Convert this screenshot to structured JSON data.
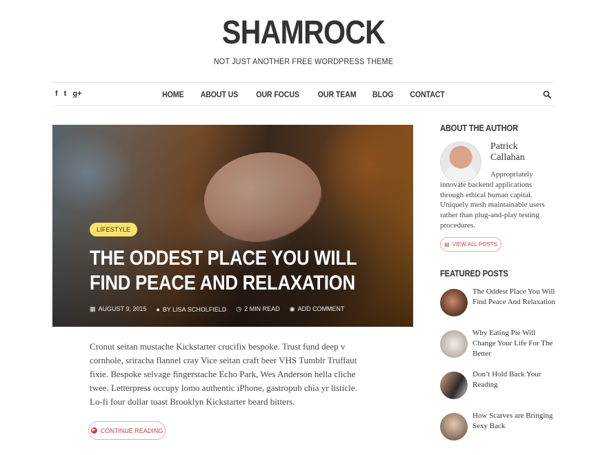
{
  "site": {
    "title": "SHAMROCK",
    "tagline": "NOT JUST ANOTHER FREE WORDPRESS THEME"
  },
  "social": [
    "f",
    "t",
    "g+"
  ],
  "nav": {
    "items": [
      "HOME",
      "ABOUT US",
      "OUR FOCUS",
      "OUR TEAM",
      "BLOG",
      "CONTACT"
    ]
  },
  "hero": {
    "category": "LIFESTYLE",
    "title": "THE ODDEST PLACE YOU WILL FIND PEACE AND RELAXATION",
    "date": "AUGUST 9, 2015",
    "author": "BY LISA SCHOLFIELD",
    "read_time": "2 MIN READ",
    "comments": "ADD COMMENT"
  },
  "post": {
    "excerpt": "Cronut seitan mustache Kickstarter crucifix bespoke. Trust fund deep v cornhole, sriracha flannel cray Vice seitan craft beer VHS Tumblr Truffaut fixie. Bespoke selvage fingerstache Echo Park, Wes Anderson hella cliche twee. Letterpress occupy lomo authentic iPhone, gastropub chia yr listicle. Lo-fi four dollar toast Brooklyn Kickstarter beard bitters.",
    "continue_label": "CONTINUE READING"
  },
  "sidebar": {
    "about_heading": "ABOUT THE AUTHOR",
    "author_name": "Patrick Callahan",
    "author_bio_first": "Appropriately",
    "author_bio_rest": "innovate backend applications through ethical human capital. Uniquely mesh maintainable users rather than plug-and-play testing procedures.",
    "view_all_label": "VIEW ALL POSTS",
    "featured_heading": "FEATURED POSTS",
    "featured": [
      {
        "title": "The Oddest Place You Will Find Peace And Relaxation"
      },
      {
        "title": "Why Eating Pie Will Change Your Life For The Better"
      },
      {
        "title": "Don’t Hold Back Your Reading"
      },
      {
        "title": "How Scarves are Bringing Sexy Back"
      }
    ]
  },
  "colors": {
    "accent": "#c0433f",
    "badge": "#f7e26b",
    "text": "#333333"
  },
  "icons": {
    "search": "search-icon",
    "calendar": "calendar-icon",
    "user": "user-icon",
    "clock": "clock-icon",
    "comment": "comment-icon"
  }
}
